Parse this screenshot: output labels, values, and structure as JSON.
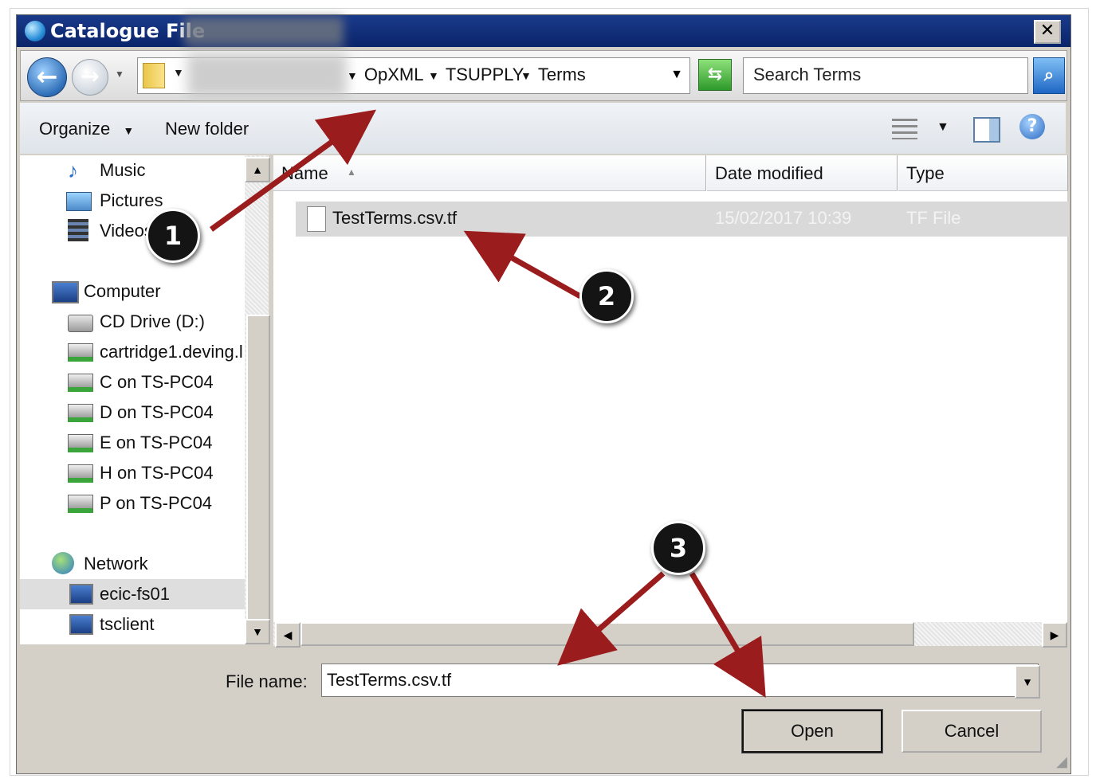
{
  "window": {
    "title": "Catalogue File",
    "close_label": "✕"
  },
  "address": {
    "breadcrumbs": [
      "OpXML",
      "TSUPPLY",
      "Terms"
    ],
    "search_placeholder": "Search Terms"
  },
  "toolbar": {
    "organize_label": "Organize",
    "new_folder_label": "New folder"
  },
  "sidebar": {
    "items": [
      {
        "label": "Music",
        "icon": "music-icon"
      },
      {
        "label": "Pictures",
        "icon": "pictures-icon"
      },
      {
        "label": "Videos",
        "icon": "videos-icon"
      },
      {
        "label": "Computer",
        "icon": "computer-icon"
      },
      {
        "label": "CD Drive (D:)",
        "icon": "cd-drive-icon"
      },
      {
        "label": "cartridge1.deving.l",
        "icon": "network-drive-icon"
      },
      {
        "label": "C on TS-PC04",
        "icon": "network-drive-icon"
      },
      {
        "label": "D on TS-PC04",
        "icon": "network-drive-icon"
      },
      {
        "label": "E on TS-PC04",
        "icon": "network-drive-icon"
      },
      {
        "label": "H on TS-PC04",
        "icon": "network-drive-icon"
      },
      {
        "label": "P on TS-PC04",
        "icon": "network-drive-icon"
      },
      {
        "label": "Network",
        "icon": "network-icon"
      },
      {
        "label": "ecic-fs01",
        "icon": "network-computer-icon",
        "selected": true
      },
      {
        "label": "tsclient",
        "icon": "network-computer-icon"
      }
    ]
  },
  "file_list": {
    "columns": [
      "Name",
      "Date modified",
      "Type"
    ],
    "rows": [
      {
        "name": "TestTerms.csv.tf",
        "date": "15/02/2017 10:39",
        "type": "TF File"
      }
    ]
  },
  "footer": {
    "file_name_label": "File name:",
    "file_name_value": "TestTerms.csv.tf",
    "open_label": "Open",
    "cancel_label": "Cancel"
  },
  "annotations": {
    "callouts": [
      "1",
      "2",
      "3"
    ],
    "arrow_color": "#9b1c1c"
  },
  "colors": {
    "titlebar": "#0a246a",
    "selection": "#d9d9d9",
    "dialog_bg": "#d4d0c8"
  }
}
